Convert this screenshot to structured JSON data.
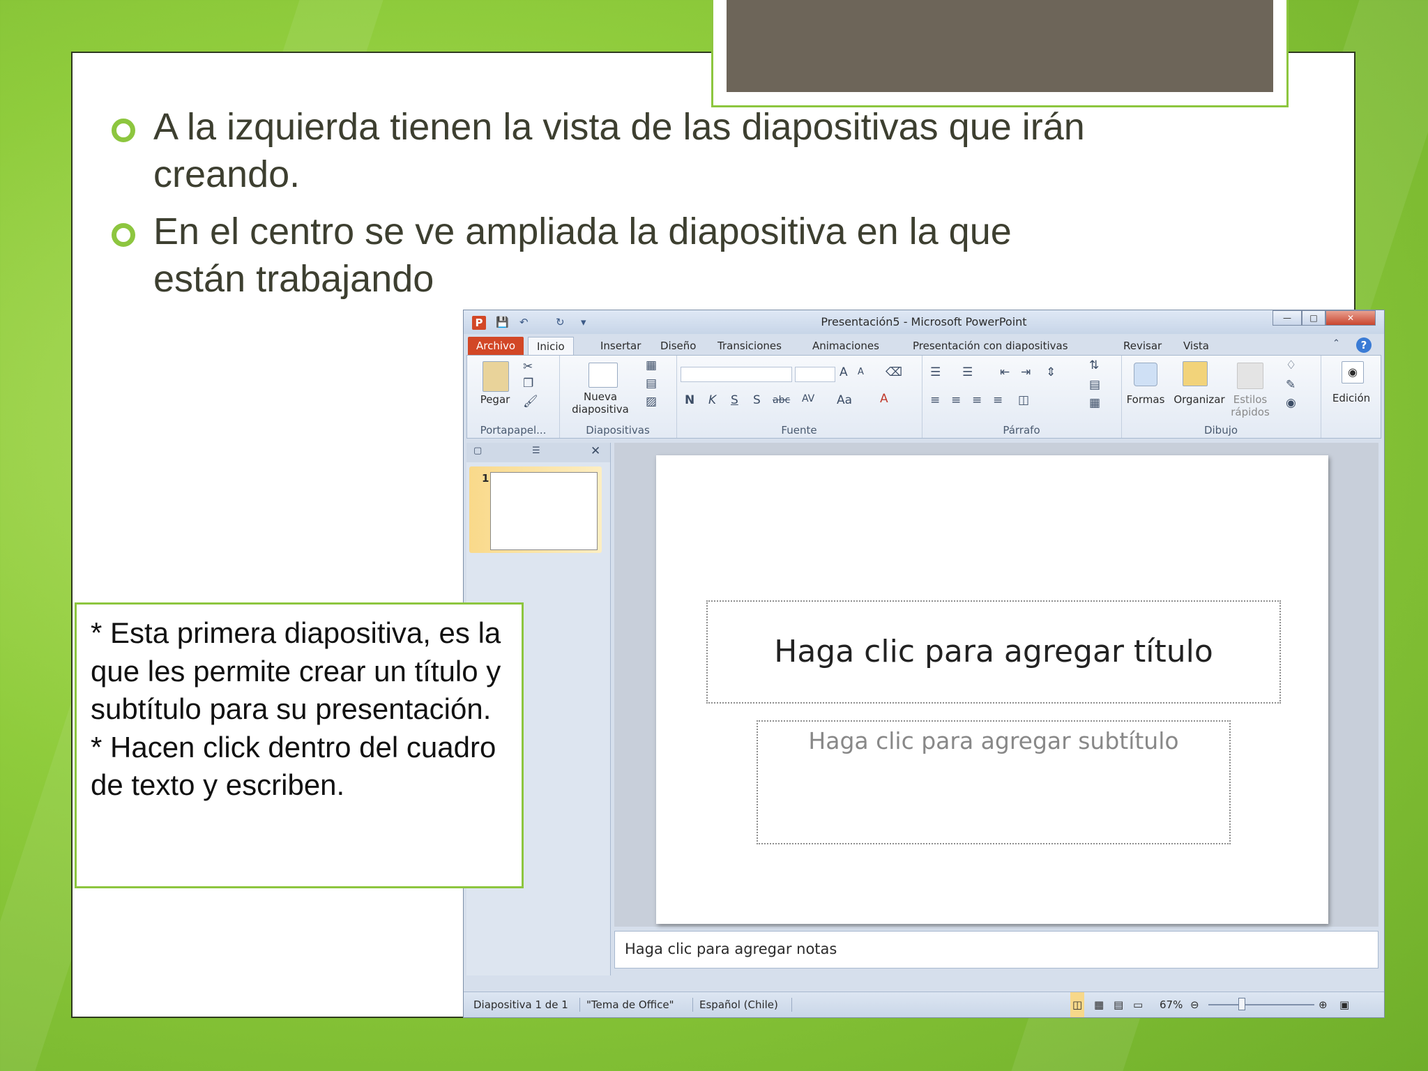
{
  "slide": {
    "bullets": [
      "A la izquierda tienen la vista de las diapositivas que irán creando.",
      "En el centro se ve ampliada la diapositiva en la que están trabajando"
    ],
    "callout": {
      "line1": "* Esta primera diapositiva, es la que les permite crear un título y subtítulo para su presentación.",
      "line2": "* Hacen click dentro del cuadro de texto y escriben."
    },
    "accent_color": "#8dc63f"
  },
  "ppt": {
    "window_title": "Presentación5 - Microsoft PowerPoint",
    "app_icon": "P",
    "tabs": [
      "Archivo",
      "Inicio",
      "Insertar",
      "Diseño",
      "Transiciones",
      "Animaciones",
      "Presentación con diapositivas",
      "Revisar",
      "Vista"
    ],
    "ribbon": {
      "paste_label": "Pegar",
      "new_slide_label_1": "Nueva",
      "new_slide_label_2": "diapositiva",
      "font_bold": "N",
      "font_italic": "K",
      "font_underline": "S",
      "font_shadow": "S",
      "font_strike": "abc",
      "font_spacing": "AV",
      "font_case": "Aa",
      "font_color": "A",
      "grow_font": "A",
      "shrink_font": "A",
      "shapes_label": "Formas",
      "arrange_label": "Organizar",
      "styles_label_1": "Estilos",
      "styles_label_2": "rápidos",
      "editing_label": "Edición",
      "groups": [
        "Portapapel...",
        "Diapositivas",
        "Fuente",
        "Párrafo",
        "Dibujo"
      ]
    },
    "thumbnail_number": "1",
    "title_placeholder": "Haga clic para agregar título",
    "subtitle_placeholder": "Haga clic para agregar subtítulo",
    "notes_placeholder": "Haga clic para agregar notas",
    "status": {
      "slide_info": "Diapositiva 1 de 1",
      "theme": "\"Tema de Office\"",
      "language": "Español (Chile)",
      "zoom": "67%"
    },
    "zoom_level": 0.67
  }
}
